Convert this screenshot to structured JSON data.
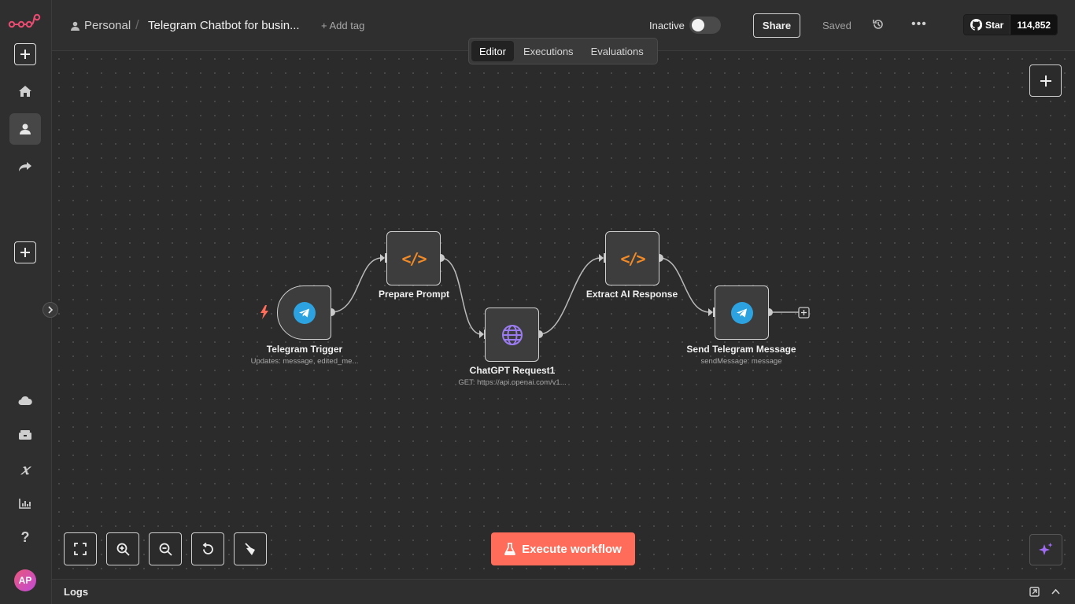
{
  "app": {
    "name": "n8n"
  },
  "breadcrumb": {
    "project": "Personal",
    "workflow_title": "Telegram Chatbot for busin...",
    "add_tag": "+ Add tag"
  },
  "header": {
    "status_label": "Inactive",
    "share_label": "Share",
    "saved_label": "Saved"
  },
  "github": {
    "star_label": "Star",
    "star_count": "114,852"
  },
  "tabs": [
    {
      "label": "Editor",
      "active": true
    },
    {
      "label": "Executions",
      "active": false
    },
    {
      "label": "Evaluations",
      "active": false
    }
  ],
  "nodes": [
    {
      "name": "Telegram Trigger",
      "subtitle": "Updates: message, edited_me...",
      "icon": "telegram-icon"
    },
    {
      "name": "Prepare Prompt",
      "subtitle": "",
      "icon": "code-icon"
    },
    {
      "name": "ChatGPT Request1",
      "subtitle": "GET: https://api.openai.com/v1...",
      "icon": "globe-icon"
    },
    {
      "name": "Extract AI Response",
      "subtitle": "",
      "icon": "code-icon"
    },
    {
      "name": "Send Telegram Message",
      "subtitle": "sendMessage: message",
      "icon": "telegram-icon"
    }
  ],
  "actions": {
    "execute_label": "Execute workflow"
  },
  "logs": {
    "title": "Logs"
  },
  "user": {
    "initials": "AP"
  },
  "colors": {
    "accent": "#ff6d5a",
    "telegram": "#2ca3e0",
    "code": "#f28b27",
    "http": "#9b7cf0"
  }
}
